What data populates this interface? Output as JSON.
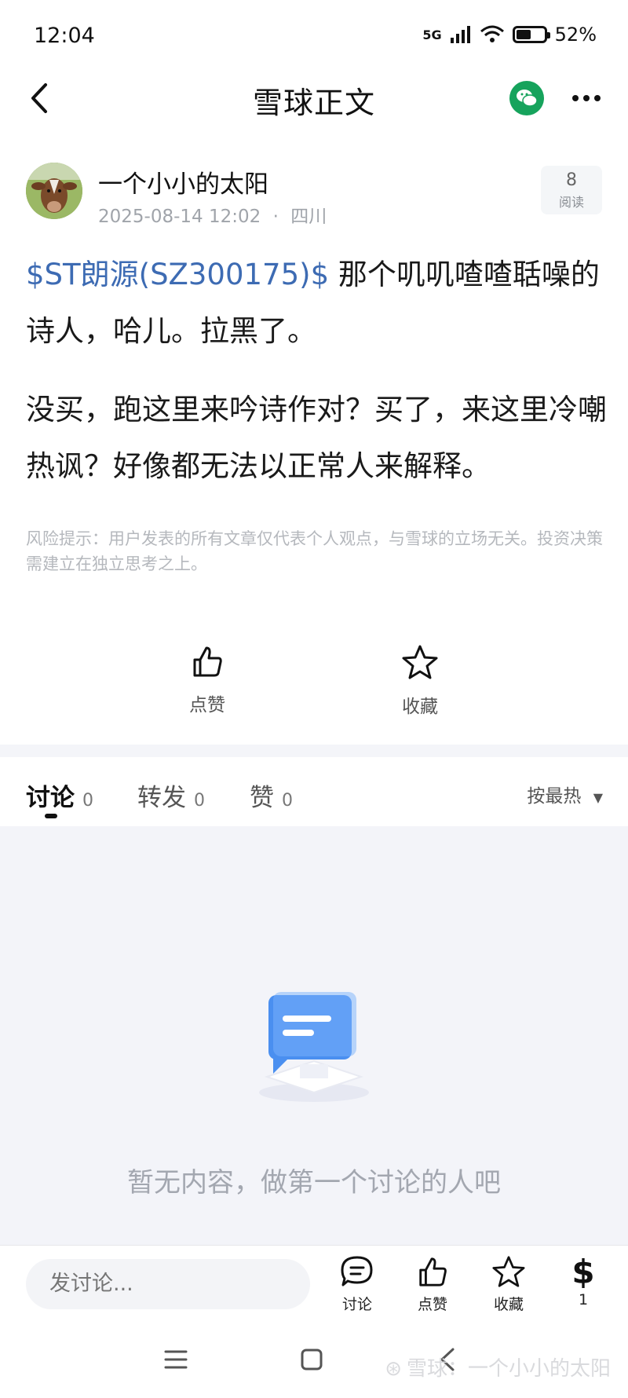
{
  "status_bar": {
    "time": "12:04",
    "network": "5G",
    "battery": "52%",
    "battery_level": 0.52
  },
  "nav": {
    "title": "雪球正文"
  },
  "post": {
    "author": "一个小小的太阳",
    "date": "2025-08-14 12:02",
    "location": "四川",
    "meta_separator": "·",
    "read_count": "8",
    "read_label": "阅读",
    "stock_tag": "$ST朗源(SZ300175)$",
    "para1_text": " 那个叽叽喳喳聒噪的诗人，哈儿。拉黑了。",
    "para2": "没买，跑这里来吟诗作对？买了，来这里冷嘲热讽？好像都无法以正常人来解释。",
    "risk_notice": "风险提示：用户发表的所有文章仅代表个人观点，与雪球的立场无关。投资决策需建立在独立思考之上。"
  },
  "actions": {
    "like": "点赞",
    "favorite": "收藏"
  },
  "tabs": [
    {
      "label": "讨论",
      "count": "0"
    },
    {
      "label": "转发",
      "count": "0"
    },
    {
      "label": "赞",
      "count": "0"
    }
  ],
  "sort_label": "按最热",
  "empty_text": "暂无内容，做第一个讨论的人吧",
  "bottom_bar": {
    "input_placeholder": "发讨论...",
    "discuss": "讨论",
    "like": "点赞",
    "favorite": "收藏",
    "reward_symbol": "$",
    "reward_count": "1"
  },
  "watermark": "雪球：一个小小的太阳",
  "colors": {
    "stock_link": "#3d6bb3",
    "wechat": "#16a35c",
    "empty_bg": "#f3f4f9"
  }
}
